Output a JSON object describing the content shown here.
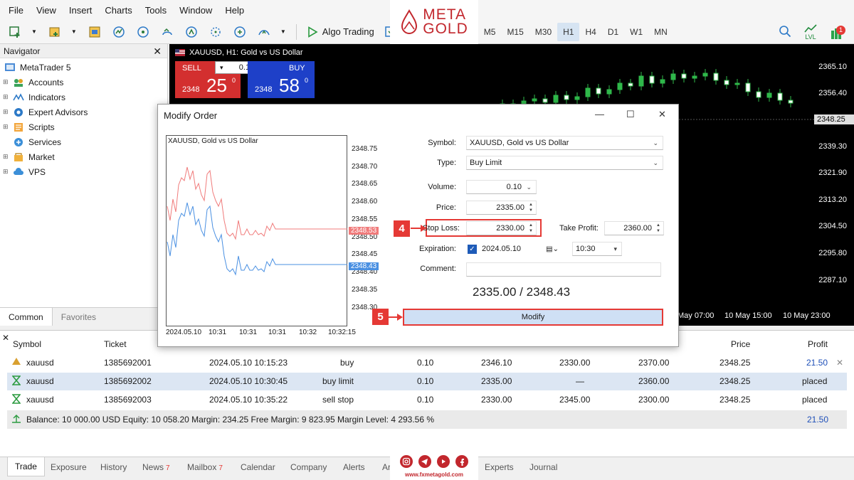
{
  "menu": [
    "File",
    "View",
    "Insert",
    "Charts",
    "Tools",
    "Window",
    "Help"
  ],
  "toolbar": {
    "algo_label": "Algo Trading",
    "timeframes": [
      "M5",
      "M15",
      "M30",
      "H1",
      "H4",
      "D1",
      "W1",
      "MN"
    ],
    "active_timeframe": "H1",
    "lvl_label": "LVL",
    "notification_count": "1"
  },
  "logo": {
    "line1": "META",
    "line2": "GOLD"
  },
  "navigator": {
    "title": "Navigator",
    "root": "MetaTrader 5",
    "items": [
      "Accounts",
      "Indicators",
      "Expert Advisors",
      "Scripts",
      "Services",
      "Market",
      "VPS"
    ],
    "tabs": [
      "Common",
      "Favorites"
    ]
  },
  "chart": {
    "title": "XAUUSD, H1:  Gold vs US Dollar",
    "sell_label": "SELL",
    "buy_label": "BUY",
    "volume": "0.10",
    "sell_big_prefix": "2348",
    "sell_big": "25",
    "sell_sup": "0",
    "buy_big_prefix": "2348",
    "buy_big": "58",
    "buy_sup": "0",
    "price_axis": [
      "2365.10",
      "2356.40",
      "2348.25",
      "2339.30",
      "2321.90",
      "2313.20",
      "2304.50",
      "2295.80",
      "2287.10"
    ],
    "current_price": "2348.25",
    "time_axis": [
      "May 07:00",
      "10 May 15:00",
      "10 May 23:00"
    ]
  },
  "dialog": {
    "title": "Modify Order",
    "mini_chart_title": "XAUUSD, Gold vs US Dollar",
    "mini_price_axis": [
      "2348.75",
      "2348.70",
      "2348.65",
      "2348.60",
      "2348.55",
      "2348.50",
      "2348.45",
      "2348.40",
      "2348.35",
      "2348.30"
    ],
    "mini_ask_tag": "2348.53",
    "mini_bid_tag": "2348.43",
    "mini_time_axis": [
      "2024.05.10",
      "10:31",
      "10:31",
      "10:31",
      "10:32",
      "10:32:15"
    ],
    "symbol_label": "Symbol:",
    "symbol_value": "XAUUSD, Gold vs US Dollar",
    "type_label": "Type:",
    "type_value": "Buy Limit",
    "volume_label": "Volume:",
    "volume_value": "0.10",
    "price_label": "Price:",
    "price_value": "2335.00",
    "sl_label": "Stop Loss:",
    "sl_value": "2330.00",
    "tp_label": "Take Profit:",
    "tp_value": "2360.00",
    "expiration_label": "Expiration:",
    "expiration_date": "2024.05.10",
    "expiration_time": "10:30",
    "comment_label": "Comment:",
    "comment_value": "",
    "price_summary": "2335.00 / 2348.43",
    "modify_label": "Modify",
    "step4": "4",
    "step5": "5"
  },
  "trade": {
    "headers": {
      "symbol": "Symbol",
      "ticket": "Ticket",
      "price": "Price",
      "profit": "Profit"
    },
    "rows": [
      {
        "symbol": "xauusd",
        "ticket": "1385692001",
        "time": "2024.05.10 10:15:23",
        "type": "buy",
        "volume": "0.10",
        "open": "2346.10",
        "sl": "2330.00",
        "tp": "2370.00",
        "price": "2348.25",
        "profit": "21.50"
      },
      {
        "symbol": "xauusd",
        "ticket": "1385692002",
        "time": "2024.05.10 10:30:45",
        "type": "buy limit",
        "volume": "0.10",
        "open": "2335.00",
        "sl": "—",
        "tp": "2360.00",
        "price": "2348.25",
        "profit": "placed"
      },
      {
        "symbol": "xauusd",
        "ticket": "1385692003",
        "time": "2024.05.10 10:35:22",
        "type": "sell stop",
        "volume": "0.10",
        "open": "2330.00",
        "sl": "2345.00",
        "tp": "2300.00",
        "price": "2348.25",
        "profit": "placed"
      }
    ],
    "balance_line": "Balance: 10 000.00  USD   Equity: 10 058.20   Margin: 234.25   Free Margin: 9 823.95   Margin Level: 4 293.56 %",
    "balance_profit": "21.50"
  },
  "bottom_tabs": {
    "items": [
      "Trade",
      "Exposure",
      "History",
      "News",
      "Mailbox",
      "Calendar",
      "Company",
      "Alerts",
      "Ar",
      "Experts",
      "Journal"
    ],
    "news_badge": "7",
    "mailbox_badge": "7"
  },
  "social": {
    "url": "www.fxmetagold.com"
  },
  "colors": {
    "sell": "#d32f2f",
    "buy": "#1e40c8",
    "accent_red": "#e53935",
    "profit_blue": "#1e4fb8"
  }
}
